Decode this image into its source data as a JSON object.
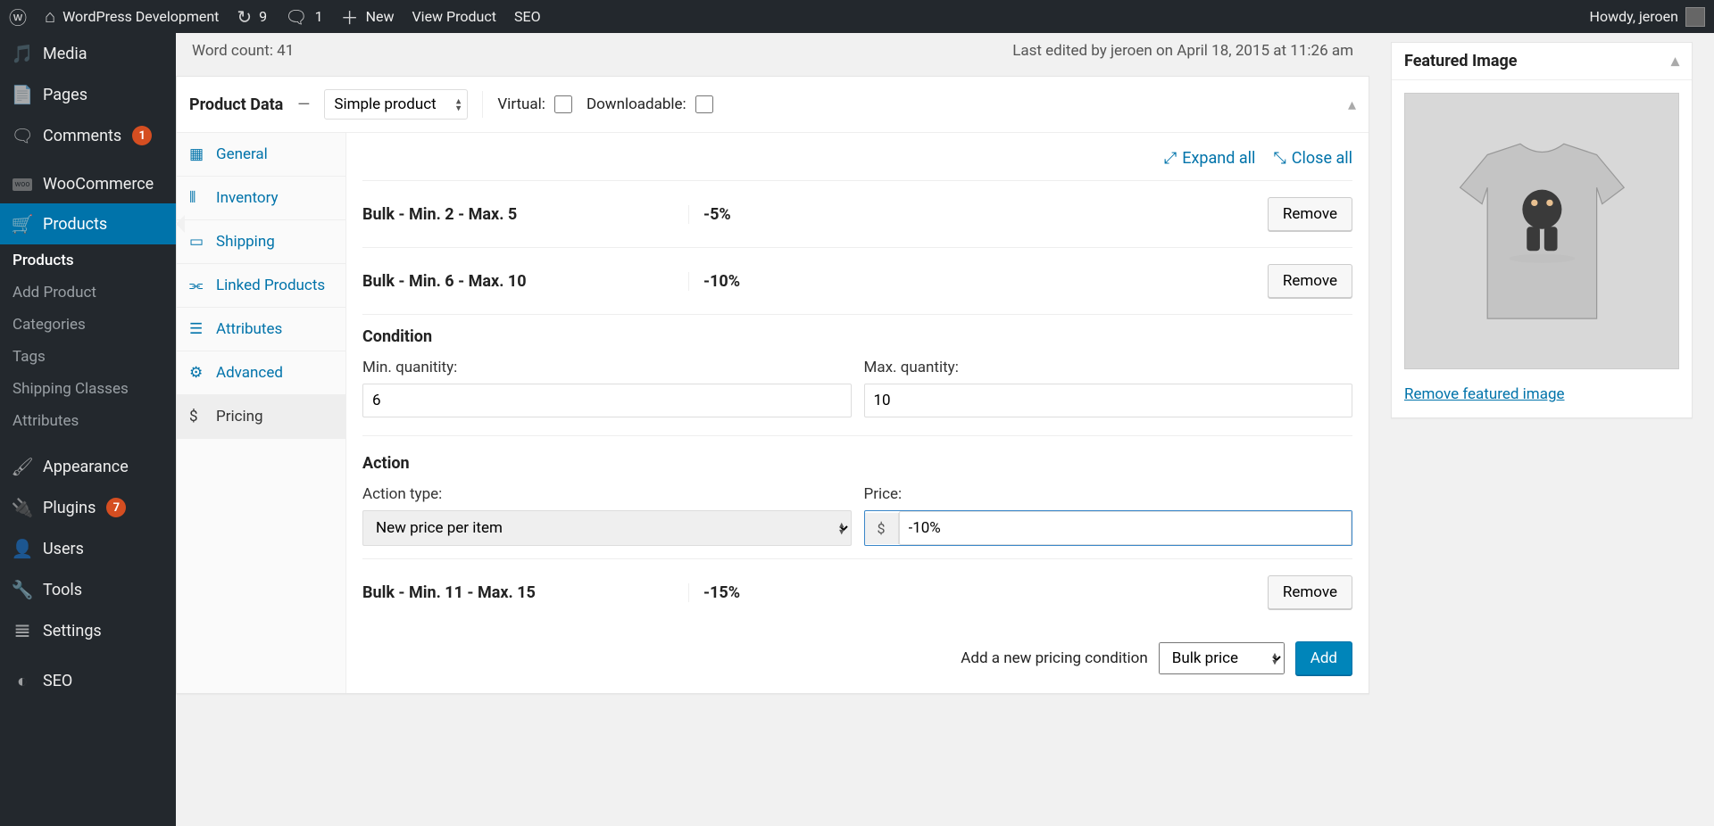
{
  "adminbar": {
    "site_title": "WordPress Development",
    "updates_count": "9",
    "comments_count": "1",
    "new_label": "New",
    "view_product_label": "View Product",
    "seo_label": "SEO",
    "howdy": "Howdy, jeroen"
  },
  "menu": {
    "media": "Media",
    "pages": "Pages",
    "comments": "Comments",
    "comments_badge": "1",
    "woocommerce": "WooCommerce",
    "products": "Products",
    "appearance": "Appearance",
    "plugins": "Plugins",
    "plugins_badge": "7",
    "users": "Users",
    "tools": "Tools",
    "settings": "Settings",
    "seo": "SEO"
  },
  "submenu": {
    "products": "Products",
    "add_product": "Add Product",
    "categories": "Categories",
    "tags": "Tags",
    "shipping_classes": "Shipping Classes",
    "attributes": "Attributes"
  },
  "info": {
    "word_count": "Word count: 41",
    "last_edited": "Last edited by jeroen on April 18, 2015 at 11:26 am"
  },
  "product_data": {
    "title": "Product Data",
    "separator": "—",
    "type_selected": "Simple product",
    "virtual_label": "Virtual:",
    "downloadable_label": "Downloadable:",
    "tabs": {
      "general": "General",
      "inventory": "Inventory",
      "shipping": "Shipping",
      "linked": "Linked Products",
      "attributes": "Attributes",
      "advanced": "Advanced",
      "pricing": "Pricing"
    },
    "toolbar": {
      "expand_all": "Expand all",
      "close_all": "Close all"
    },
    "rules": [
      {
        "label": "Bulk - Min. 2 - Max. 5",
        "value": "-5%",
        "remove": "Remove"
      },
      {
        "label": "Bulk - Min. 6 - Max. 10",
        "value": "-10%",
        "remove": "Remove"
      }
    ],
    "condition": {
      "title": "Condition",
      "min_label": "Min. quanitity:",
      "max_label": "Max. quantity:",
      "min_value": "6",
      "max_value": "10"
    },
    "action": {
      "title": "Action",
      "action_type_label": "Action type:",
      "action_type_value": "New price per item",
      "price_label": "Price:",
      "currency": "$",
      "price_value": "-10%"
    },
    "last_rule": {
      "label": "Bulk - Min. 11 - Max. 15",
      "value": "-15%",
      "remove": "Remove"
    },
    "add_row": {
      "label": "Add a new pricing condition",
      "select_value": "Bulk price",
      "button": "Add"
    }
  },
  "featured_image": {
    "title": "Featured Image",
    "remove_link": "Remove featured image"
  }
}
